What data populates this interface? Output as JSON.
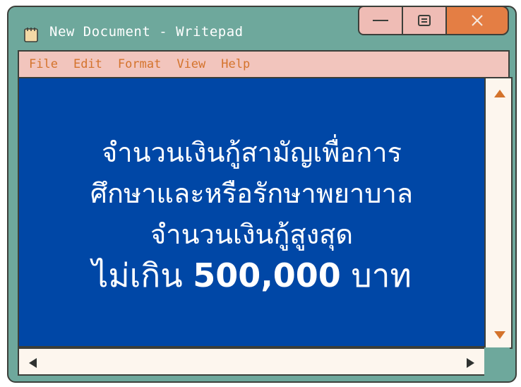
{
  "window": {
    "title": "New Document - Writepad",
    "controls": {
      "minimize_icon": "minimize-icon",
      "maximize_icon": "maximize-icon",
      "close_icon": "close-icon"
    }
  },
  "menu": {
    "items": [
      {
        "label": "File"
      },
      {
        "label": "Edit"
      },
      {
        "label": "Format"
      },
      {
        "label": "View"
      },
      {
        "label": "Help"
      }
    ]
  },
  "document": {
    "line1": "จำนวนเงินกู้สามัญเพื่อการ",
    "line2": "ศึกษาและหรือรักษาพยาบาล",
    "line3": "จำนวนเงินกู้สูงสุด",
    "line4_prefix": "ไม่เกิน",
    "line4_amount": "500,000",
    "line4_suffix": "บาท"
  },
  "colors": {
    "window_bg": "#6ea89c",
    "menubar_bg": "#f2c5bd",
    "menu_text": "#d4732c",
    "content_bg": "#0047a6",
    "close_button": "#e47e44",
    "scrollbar_bg": "#fdf6ee"
  }
}
